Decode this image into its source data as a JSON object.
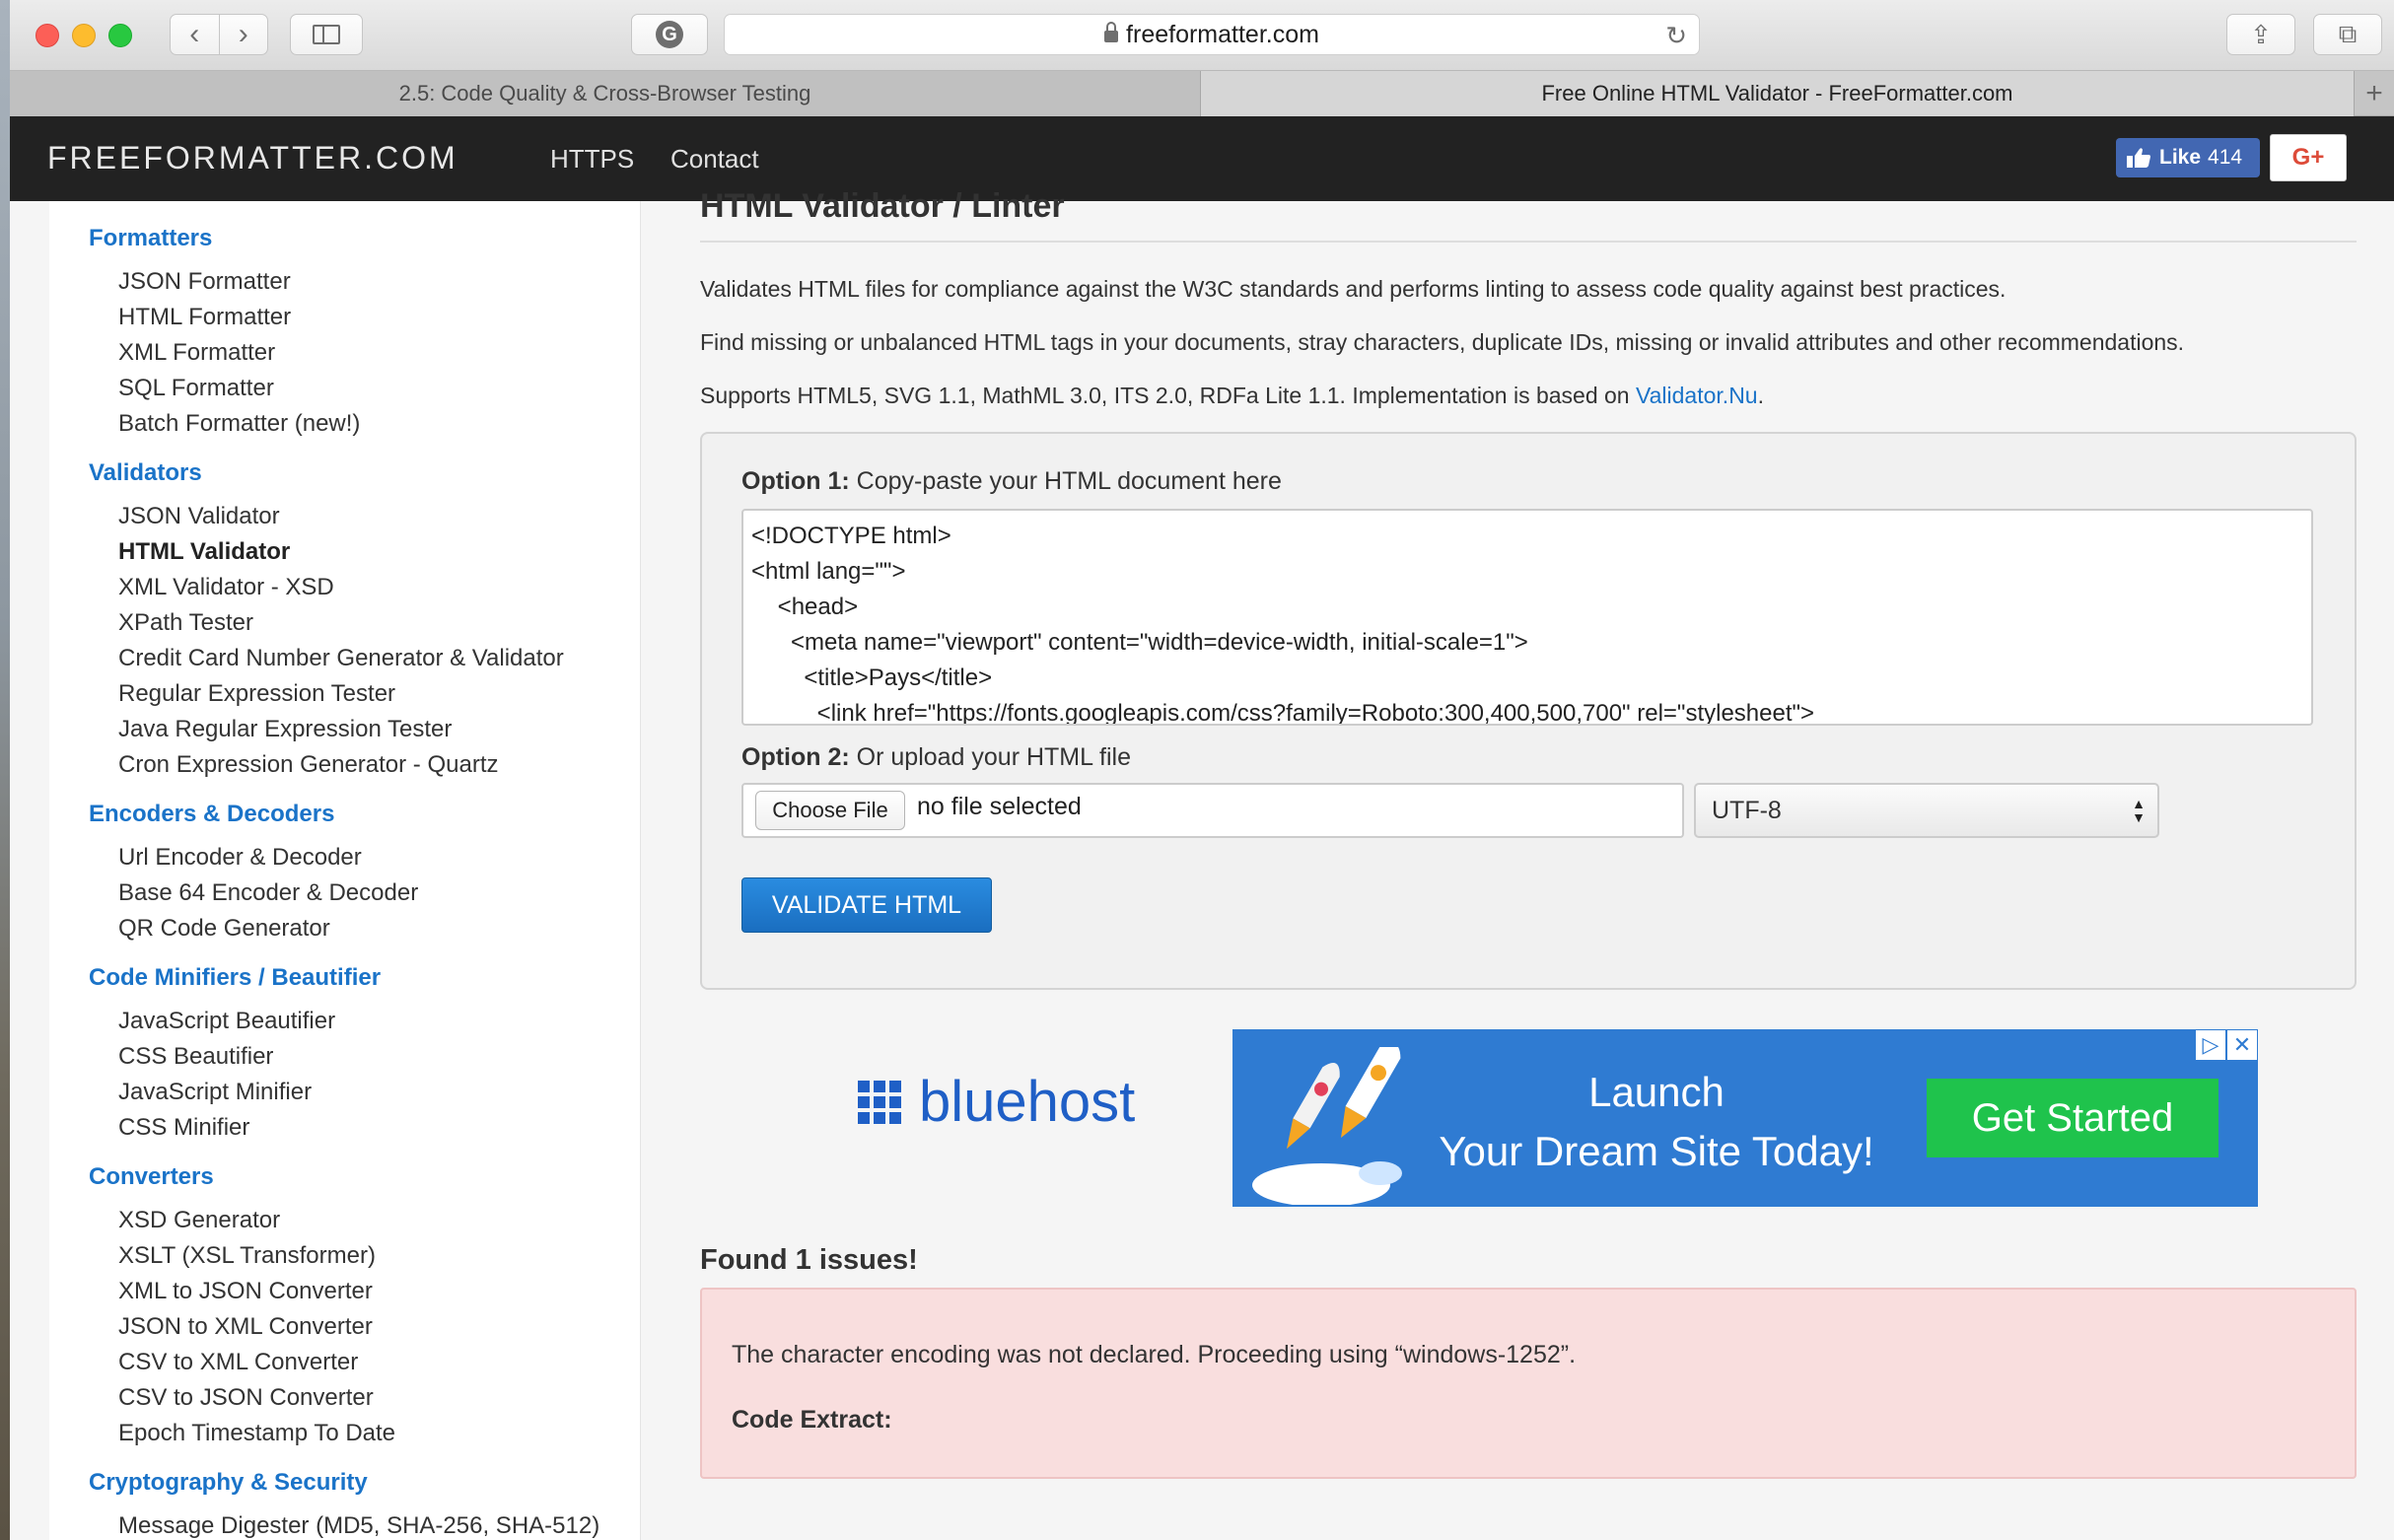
{
  "browser": {
    "url": "freeformatter.com",
    "tabs": [
      "2.5: Code Quality & Cross-Browser Testing",
      "Free Online HTML Validator - FreeFormatter.com"
    ],
    "new_tab": "+"
  },
  "header": {
    "brand": "FREEFORMATTER.COM",
    "nav": [
      "HTTPS",
      "Contact"
    ],
    "fb_like_label": "Like",
    "fb_like_count": "414",
    "gplus_label": "G+"
  },
  "sidebar": {
    "formatters": {
      "title": "Formatters",
      "items": [
        "JSON Formatter",
        "HTML Formatter",
        "XML Formatter",
        "SQL Formatter",
        "Batch Formatter (new!)"
      ]
    },
    "validators": {
      "title": "Validators",
      "items": [
        "JSON Validator",
        "HTML Validator",
        "XML Validator - XSD",
        "XPath Tester",
        "Credit Card Number Generator & Validator",
        "Regular Expression Tester",
        "Java Regular Expression Tester",
        "Cron Expression Generator - Quartz"
      ]
    },
    "encoders": {
      "title": "Encoders & Decoders",
      "items": [
        "Url Encoder & Decoder",
        "Base 64 Encoder & Decoder",
        "QR Code Generator"
      ]
    },
    "minifiers": {
      "title": "Code Minifiers / Beautifier",
      "items": [
        "JavaScript Beautifier",
        "CSS Beautifier",
        "JavaScript Minifier",
        "CSS Minifier"
      ]
    },
    "converters": {
      "title": "Converters",
      "items": [
        "XSD Generator",
        "XSLT (XSL Transformer)",
        "XML to JSON Converter",
        "JSON to XML Converter",
        "CSV to XML Converter",
        "CSV to JSON Converter",
        "Epoch Timestamp To Date"
      ]
    },
    "crypto": {
      "title": "Cryptography & Security",
      "items": [
        "Message Digester (MD5, SHA-256, SHA-512)"
      ]
    }
  },
  "main": {
    "title": "HTML Validator / Linter",
    "para1": "Validates HTML files for compliance against the W3C standards and performs linting to assess code quality against best practices.",
    "para2": "Find missing or unbalanced HTML tags in your documents, stray characters, duplicate IDs, missing or invalid attributes and other recommendations.",
    "para3_pre": "Supports HTML5, SVG 1.1, MathML 3.0, ITS 2.0, RDFa Lite 1.1. Implementation is based on ",
    "para3_link": "Validator.Nu",
    "para3_post": ".",
    "option1_bold": "Option 1:",
    "option1_text": " Copy-paste your HTML document here",
    "code": "<!DOCTYPE html>\n<html lang=\"\">\n    <head>\n      <meta name=\"viewport\" content=\"width=device-width, initial-scale=1\">\n        <title>Pays</title>\n          <link href=\"https://fonts.googleapis.com/css?family=Roboto:300,400,500,700\" rel=\"stylesheet\">",
    "option2_bold": "Option 2:",
    "option2_text": " Or upload your HTML file",
    "choose_file": "Choose File",
    "no_file": "no file selected",
    "encoding": "UTF-8",
    "validate_button": "VALIDATE HTML",
    "found": "Found 1 issues!",
    "issue_message": "The character encoding was not declared. Proceeding using “windows-1252”.",
    "code_extract": "Code Extract:"
  },
  "ad": {
    "brand": "bluehost",
    "headline_line1": "Launch",
    "headline_line2": "Your Dream Site Today!",
    "cta": "Get Started",
    "adchoices": "▷",
    "close": "✕"
  },
  "colors": {
    "accent": "#1a73c8",
    "header_bg": "#222222",
    "alert_bg": "#f9dede",
    "ad_bg": "#2f7bd2",
    "cta_green": "#1fc34c"
  }
}
